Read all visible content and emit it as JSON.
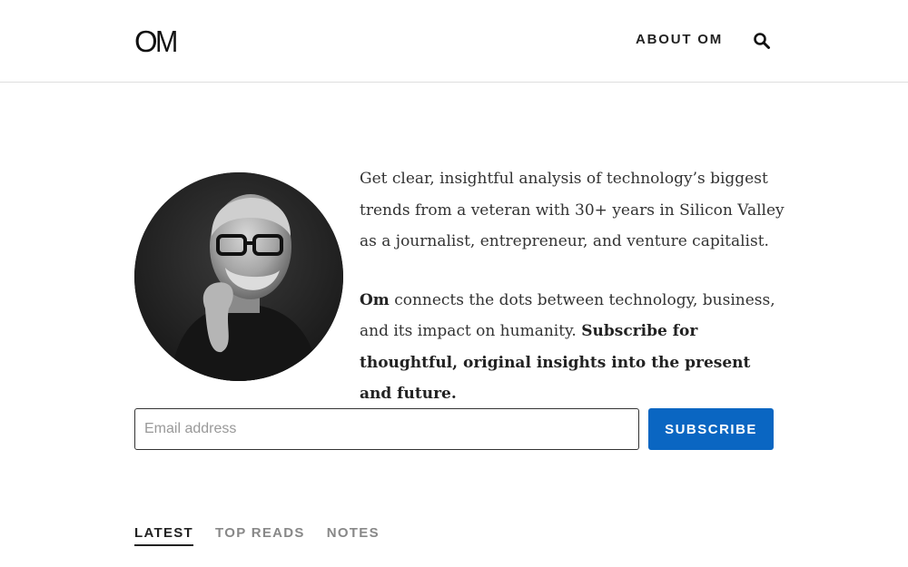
{
  "header": {
    "logo_o": "O",
    "logo_m": "M",
    "about_label": "ABOUT OM",
    "search_icon": "magnifier"
  },
  "intro": {
    "line1": "Get clear, insightful analysis of technology’s biggest trends from a veteran with 30+ years in Silicon Valley as a journalist, entrepreneur, and venture capitalist.",
    "p2_name": "Om",
    "p2_text": " connects the dots between technology, business, and its impact on humanity. ",
    "p2_cta": "Subscribe for thoughtful, original insights into the present and future."
  },
  "subscribe": {
    "email_placeholder": "Email address",
    "button_label": "SUBSCRIBE",
    "accent": "#0a66c2"
  },
  "tabs": [
    {
      "label": "LATEST",
      "active": true
    },
    {
      "label": "TOP READS",
      "active": false
    },
    {
      "label": "NOTES",
      "active": false
    }
  ]
}
